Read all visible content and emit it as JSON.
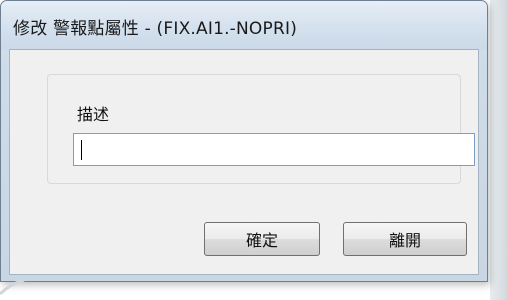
{
  "window": {
    "title": "修改 警報點屬性  - (FIX.AI1.-NOPRI)"
  },
  "form": {
    "description_label": "描述",
    "description_value": ""
  },
  "buttons": {
    "ok_label": "確定",
    "cancel_label": "離開"
  }
}
